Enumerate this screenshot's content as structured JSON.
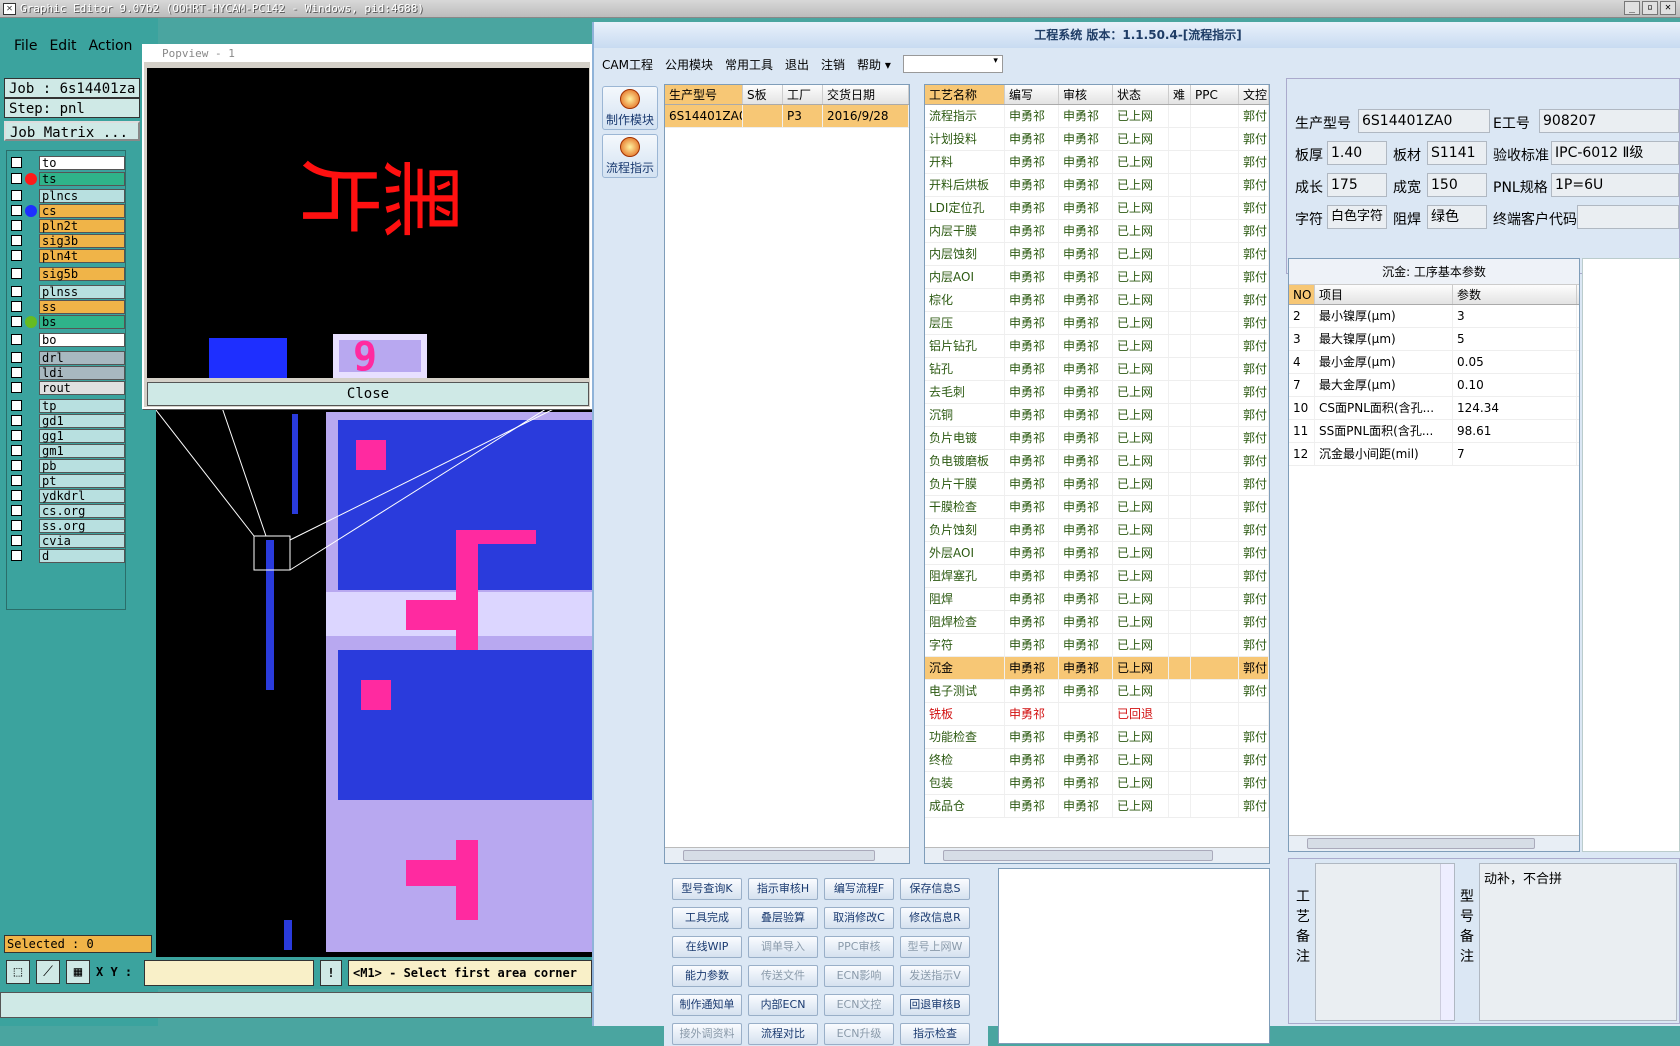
{
  "ge": {
    "title": "Graphic Editor 9.07b2 (OOHRT-HYCAM-PC142 - Windows, pid:4688)",
    "menu": [
      "File",
      "Edit",
      "Action"
    ],
    "job": "Job : 6s14401za",
    "step": "Step: pnl",
    "job_matrix": "Job Matrix ...",
    "layers": [
      {
        "name": "to",
        "color": "#ffffff"
      },
      {
        "name": "ts",
        "color": "#2fb38a",
        "dot": "#ff1a1a"
      },
      {
        "name": "plncs",
        "color": "#b8e0e0"
      },
      {
        "name": "cs",
        "color": "#f0b448",
        "dot": "#1e2fff"
      },
      {
        "name": "pln2t",
        "color": "#f0b448"
      },
      {
        "name": "sig3b",
        "color": "#f0b448"
      },
      {
        "name": "pln4t",
        "color": "#f0b448"
      },
      {
        "name": "sig5b",
        "color": "#f0b448"
      },
      {
        "name": "plnss",
        "color": "#b8e0e0"
      },
      {
        "name": "ss",
        "color": "#f0b448"
      },
      {
        "name": "bs",
        "color": "#2fb38a",
        "dot": "#66bb22"
      },
      {
        "name": "bo",
        "color": "#ffffff"
      },
      {
        "name": "drl",
        "color": "#a8b8c0"
      },
      {
        "name": "ldi",
        "color": "#a8b8c0"
      },
      {
        "name": "rout",
        "color": "#e0e0e0"
      },
      {
        "name": "tp",
        "color": "#b8e0e0"
      },
      {
        "name": "gd1",
        "color": "#b8e0e0"
      },
      {
        "name": "gg1",
        "color": "#b8e0e0"
      },
      {
        "name": "gm1",
        "color": "#b8e0e0"
      },
      {
        "name": "pb",
        "color": "#b8e0e0"
      },
      {
        "name": "pt",
        "color": "#b8e0e0"
      },
      {
        "name": "ydkdrl",
        "color": "#b8e0e0"
      },
      {
        "name": "cs.org",
        "color": "#b8e0e0"
      },
      {
        "name": "ss.org",
        "color": "#b8e0e0"
      },
      {
        "name": "cvia",
        "color": "#b8e0e0"
      },
      {
        "name": "d",
        "color": "#b8e0e0"
      }
    ],
    "popview_title": "Popview - 1",
    "popview_text": "黑片",
    "popview_code": "9",
    "close_label": "Close",
    "selected": "Selected : 0",
    "xy_label": "X Y :",
    "excl": "!",
    "prompt": "<M1> - Select first area corner"
  },
  "cam": {
    "title": "工程系统 版本：1.1.50.4-[流程指示]",
    "menu": [
      "CAM工程",
      "公用模块",
      "常用工具",
      "退出",
      "注销",
      "帮助"
    ],
    "side_buttons": [
      "制作模块",
      "流程指示"
    ],
    "orders": {
      "headers": [
        "生产型号",
        "S板",
        "工厂",
        "交货日期"
      ],
      "rows": [
        [
          "6S14401ZA0",
          "",
          "P3",
          "2016/9/28"
        ]
      ]
    },
    "process": {
      "headers": [
        "工艺名称",
        "编写",
        "审核",
        "状态",
        "难",
        "PPC",
        "文控"
      ],
      "rows": [
        [
          "流程指示",
          "申勇祁",
          "申勇祁",
          "已上网",
          "",
          "",
          "郭付"
        ],
        [
          "计划投料",
          "申勇祁",
          "申勇祁",
          "已上网",
          "",
          "",
          "郭付"
        ],
        [
          "开料",
          "申勇祁",
          "申勇祁",
          "已上网",
          "",
          "",
          "郭付"
        ],
        [
          "开料后烘板",
          "申勇祁",
          "申勇祁",
          "已上网",
          "",
          "",
          "郭付"
        ],
        [
          "LDI定位孔",
          "申勇祁",
          "申勇祁",
          "已上网",
          "",
          "",
          "郭付"
        ],
        [
          "内层干膜",
          "申勇祁",
          "申勇祁",
          "已上网",
          "",
          "",
          "郭付"
        ],
        [
          "内层蚀刻",
          "申勇祁",
          "申勇祁",
          "已上网",
          "",
          "",
          "郭付"
        ],
        [
          "内层AOI",
          "申勇祁",
          "申勇祁",
          "已上网",
          "",
          "",
          "郭付"
        ],
        [
          "棕化",
          "申勇祁",
          "申勇祁",
          "已上网",
          "",
          "",
          "郭付"
        ],
        [
          "层压",
          "申勇祁",
          "申勇祁",
          "已上网",
          "",
          "",
          "郭付"
        ],
        [
          "铝片钻孔",
          "申勇祁",
          "申勇祁",
          "已上网",
          "",
          "",
          "郭付"
        ],
        [
          "钻孔",
          "申勇祁",
          "申勇祁",
          "已上网",
          "",
          "",
          "郭付"
        ],
        [
          "去毛刺",
          "申勇祁",
          "申勇祁",
          "已上网",
          "",
          "",
          "郭付"
        ],
        [
          "沉铜",
          "申勇祁",
          "申勇祁",
          "已上网",
          "",
          "",
          "郭付"
        ],
        [
          "负片电镀",
          "申勇祁",
          "申勇祁",
          "已上网",
          "",
          "",
          "郭付"
        ],
        [
          "负电镀磨板",
          "申勇祁",
          "申勇祁",
          "已上网",
          "",
          "",
          "郭付"
        ],
        [
          "负片干膜",
          "申勇祁",
          "申勇祁",
          "已上网",
          "",
          "",
          "郭付"
        ],
        [
          "干膜检查",
          "申勇祁",
          "申勇祁",
          "已上网",
          "",
          "",
          "郭付"
        ],
        [
          "负片蚀刻",
          "申勇祁",
          "申勇祁",
          "已上网",
          "",
          "",
          "郭付"
        ],
        [
          "外层AOI",
          "申勇祁",
          "申勇祁",
          "已上网",
          "",
          "",
          "郭付"
        ],
        [
          "阻焊塞孔",
          "申勇祁",
          "申勇祁",
          "已上网",
          "",
          "",
          "郭付"
        ],
        [
          "阻焊",
          "申勇祁",
          "申勇祁",
          "已上网",
          "",
          "",
          "郭付"
        ],
        [
          "阻焊检查",
          "申勇祁",
          "申勇祁",
          "已上网",
          "",
          "",
          "郭付"
        ],
        [
          "字符",
          "申勇祁",
          "申勇祁",
          "已上网",
          "",
          "",
          "郭付"
        ],
        [
          "沉金",
          "申勇祁",
          "申勇祁",
          "已上网",
          "",
          "",
          "郭付"
        ],
        [
          "电子测试",
          "申勇祁",
          "申勇祁",
          "已上网",
          "",
          "",
          "郭付"
        ],
        [
          "铣板",
          "申勇祁",
          "",
          "已回退",
          "",
          "",
          ""
        ],
        [
          "功能检查",
          "申勇祁",
          "申勇祁",
          "已上网",
          "",
          "",
          "郭付"
        ],
        [
          "终检",
          "申勇祁",
          "申勇祁",
          "已上网",
          "",
          "",
          "郭付"
        ],
        [
          "包装",
          "申勇祁",
          "申勇祁",
          "已上网",
          "",
          "",
          "郭付"
        ],
        [
          "成品仓",
          "申勇祁",
          "申勇祁",
          "已上网",
          "",
          "",
          "郭付"
        ]
      ],
      "selected_row": 24,
      "red_row": 26
    },
    "buttons": [
      {
        "label": "型号查询K",
        "enabled": true
      },
      {
        "label": "指示审核H",
        "enabled": true
      },
      {
        "label": "编写流程F",
        "enabled": true
      },
      {
        "label": "保存信息S",
        "enabled": true
      },
      {
        "label": "工具完成",
        "enabled": true
      },
      {
        "label": "叠层验算",
        "enabled": true
      },
      {
        "label": "取消修改C",
        "enabled": true
      },
      {
        "label": "修改信息R",
        "enabled": true
      },
      {
        "label": "在线WIP",
        "enabled": true
      },
      {
        "label": "调单导入",
        "enabled": false
      },
      {
        "label": "PPC审核",
        "enabled": false
      },
      {
        "label": "型号上网W",
        "enabled": false
      },
      {
        "label": "能力参数",
        "enabled": true
      },
      {
        "label": "传送文件",
        "enabled": false
      },
      {
        "label": "ECN影响",
        "enabled": false
      },
      {
        "label": "发送指示V",
        "enabled": false
      },
      {
        "label": "制作通知单",
        "enabled": true
      },
      {
        "label": "内部ECN",
        "enabled": true
      },
      {
        "label": "ECN文控",
        "enabled": false
      },
      {
        "label": "回退审核B",
        "enabled": true
      },
      {
        "label": "接外调资料",
        "enabled": false
      },
      {
        "label": "流程对比",
        "enabled": true
      },
      {
        "label": "ECN升级",
        "enabled": false
      },
      {
        "label": "指示检查",
        "enabled": true
      }
    ],
    "info": {
      "model_label": "生产型号",
      "model": "6S14401ZA0",
      "eno_label": "E工号",
      "eno": "908207",
      "thick_label": "板厚",
      "thick": "1.40",
      "mat_label": "板材",
      "mat": "S1141",
      "std_label": "验收标准",
      "std": "IPC-6012 Ⅱ级",
      "len_label": "成长",
      "len": "175",
      "wid_label": "成宽",
      "wid": "150",
      "pnl_label": "PNL规格",
      "pnl": "1P=6U",
      "char_label": "字符",
      "char": "白色字符",
      "mask_label": "阻焊",
      "mask": "绿色",
      "cust_label": "终端客户代码",
      "cust": ""
    },
    "params": {
      "title": "沉金: 工序基本参数",
      "headers": [
        "NO",
        "项目",
        "参数"
      ],
      "rows": [
        [
          "2",
          "最小镍厚(μm)",
          "3"
        ],
        [
          "3",
          "最大镍厚(μm)",
          "5"
        ],
        [
          "4",
          "最小金厚(μm)",
          "0.05"
        ],
        [
          "7",
          "最大金厚(μm)",
          "0.10"
        ],
        [
          "10",
          "CS面PNL面积(含孔...",
          "124.34"
        ],
        [
          "11",
          "SS面PNL面积(含孔...",
          "98.61"
        ],
        [
          "12",
          "沉金最小间距(mil)",
          "7"
        ]
      ]
    },
    "memo_label1": "工艺备注",
    "memo_label2": "型号备注",
    "memo_text": "动补，不合拼"
  }
}
